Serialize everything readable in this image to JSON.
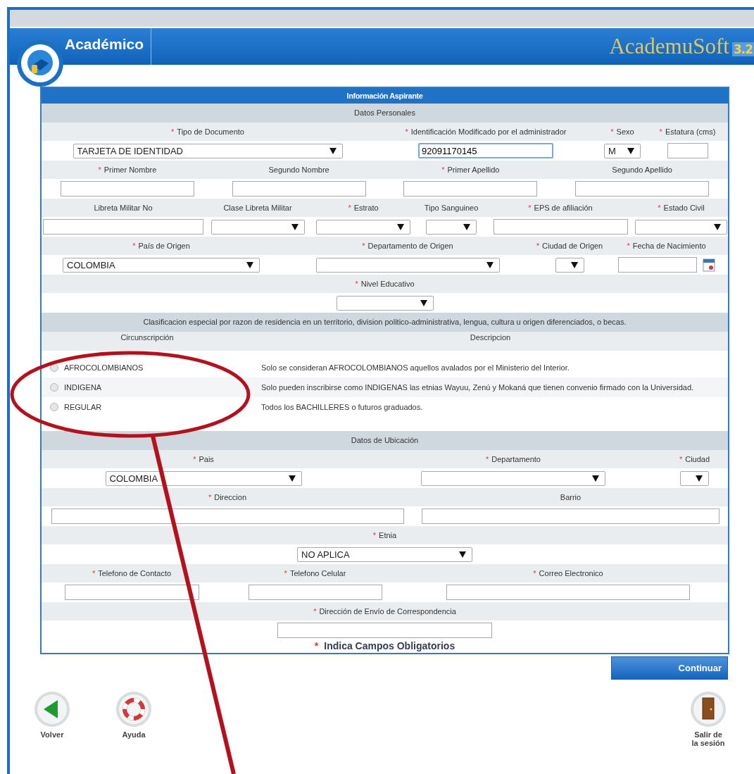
{
  "header": {
    "module": "Académico",
    "brand": "AcademuSoft",
    "version": "3.2"
  },
  "form": {
    "title": "Información Aspirante",
    "personal": {
      "title": "Datos Personales",
      "rows": [
        {
          "fields": [
            {
              "label": "Tipo de Documento",
              "mark": "*",
              "kind": "select",
              "value": "TARJETA DE IDENTIDAD"
            },
            {
              "label": "Identificación Modificado por el administrador",
              "mark": "*",
              "kind": "text",
              "value": "92091170145"
            },
            {
              "label": "Sexo",
              "mark": "*",
              "kind": "select",
              "value": "M"
            },
            {
              "label": "Estatura (cms)",
              "mark": "*",
              "kind": "text"
            }
          ]
        },
        {
          "fields": [
            {
              "label": "Primer Nombre",
              "mark": "*",
              "kind": "text"
            },
            {
              "label": "Segundo Nombre",
              "kind": "text"
            },
            {
              "label": "Primer Apellido",
              "mark": "*",
              "kind": "text"
            },
            {
              "label": "Segundo Apellido",
              "kind": "text"
            }
          ]
        },
        {
          "fields": [
            {
              "label": "Libreta Militar No",
              "kind": "text"
            },
            {
              "label": "Clase Libreta Militar",
              "kind": "select"
            },
            {
              "label": "Estrato",
              "mark": "*",
              "kind": "select"
            },
            {
              "label": "Tipo Sanguineo",
              "kind": "select"
            },
            {
              "label": "EPS de afiliación",
              "mark": "*",
              "kind": "text"
            },
            {
              "label": "Estado Civil",
              "mark": "*",
              "kind": "select"
            }
          ]
        },
        {
          "fields": [
            {
              "label": "País de Origen",
              "mark": "*",
              "kind": "select",
              "value": "COLOMBIA"
            },
            {
              "label": "Departamento de Origen",
              "mark": "*",
              "kind": "select"
            },
            {
              "label": "Ciudad de Origen",
              "mark": "*",
              "kind": "select"
            },
            {
              "label": "Fecha de Nacimiento",
              "mark": "*",
              "kind": "date"
            }
          ]
        },
        {
          "fields": [
            {
              "label": "Nivel Educativo",
              "mark": "*",
              "kind": "select"
            }
          ]
        }
      ]
    },
    "classification": {
      "title": "Clasificacion especial por razon de residencia en un territorio, division politico-administrativa, lengua, cultura u origen diferenciados, o becas.",
      "columns": [
        "Circunscripción",
        "Descripcion"
      ],
      "options": [
        {
          "name": "AFROCOLOMBIANOS",
          "description": "Solo se consideran AFROCOLOMBIANOS aquellos avalados por el Ministerio del Interior.",
          "selected": false
        },
        {
          "name": "INDIGENA",
          "description": "Solo pueden inscribirse como INDIGENAS las etnias Wayuu, Zenú y Mokaná que tienen convenio firmado con la Universidad.",
          "selected": false
        },
        {
          "name": "REGULAR",
          "description": "Todos los BACHILLERES o futuros graduados.",
          "selected": false
        }
      ]
    },
    "location": {
      "title": "Datos de Ubicación",
      "rows": [
        {
          "fields": [
            {
              "label": "Pais",
              "mark": "*",
              "kind": "select",
              "value": "COLOMBIA"
            },
            {
              "label": "Departamento",
              "mark": "*",
              "kind": "select"
            },
            {
              "label": "Ciudad",
              "mark": "*",
              "kind": "select"
            }
          ]
        },
        {
          "fields": [
            {
              "label": "Direccion",
              "mark": "*",
              "kind": "text"
            },
            {
              "label": "Barrio",
              "kind": "text"
            }
          ]
        },
        {
          "fields": [
            {
              "label": "Etnia",
              "mark": "*",
              "kind": "select",
              "value": "NO APLICA"
            }
          ]
        },
        {
          "fields": [
            {
              "label": "Telefono de Contacto",
              "mark": "*",
              "kind": "text"
            },
            {
              "label": "Telefono Celular",
              "mark": "*",
              "kind": "text"
            },
            {
              "label": "Correo Electronico",
              "mark": "*",
              "kind": "text"
            }
          ]
        },
        {
          "fields": [
            {
              "label": "Dirección de Envío de Correspondencia",
              "mark": "*",
              "kind": "text"
            }
          ]
        }
      ]
    },
    "note": {
      "mark": "*",
      "text": "Indica Campos Obligatorios"
    }
  },
  "continue_button": "Continuar",
  "footer": [
    {
      "label": "Volver",
      "kind": "back"
    },
    {
      "label": "Ayuda",
      "kind": "help"
    },
    {
      "label": "Salir de la sesión",
      "kind": "logout"
    }
  ]
}
